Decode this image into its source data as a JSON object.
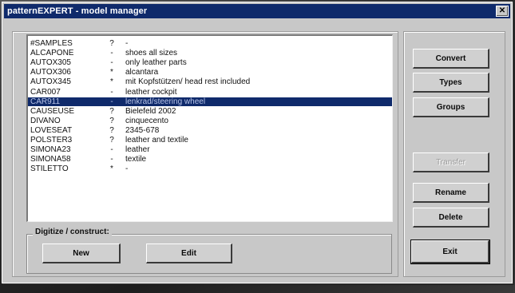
{
  "window": {
    "title": "patternEXPERT - model manager",
    "close_glyph": "✕"
  },
  "list": {
    "items": [
      {
        "name": "#SAMPLES",
        "flag": "?",
        "desc": "-"
      },
      {
        "name": "ALCAPONE",
        "flag": "-",
        "desc": "shoes all sizes"
      },
      {
        "name": "AUTOX305",
        "flag": "-",
        "desc": "only leather parts"
      },
      {
        "name": "AUTOX306",
        "flag": "*",
        "desc": "alcantara"
      },
      {
        "name": "AUTOX345",
        "flag": "*",
        "desc": "mit Kopfstützen/ head rest included"
      },
      {
        "name": "CAR007",
        "flag": "-",
        "desc": "leather cockpit"
      },
      {
        "name": "CAR911",
        "flag": "-",
        "desc": "lenkrad/steering wheel"
      },
      {
        "name": "CAUSEUSE",
        "flag": "?",
        "desc": "Bielefeld 2002"
      },
      {
        "name": "DIVANO",
        "flag": "?",
        "desc": "cinquecento"
      },
      {
        "name": "LOVESEAT",
        "flag": "?",
        "desc": "2345-678"
      },
      {
        "name": "POLSTER3",
        "flag": "?",
        "desc": "leather and textile"
      },
      {
        "name": "SIMONA23",
        "flag": "-",
        "desc": "leather"
      },
      {
        "name": "SIMONA58",
        "flag": "-",
        "desc": "textile"
      },
      {
        "name": "STILETTO",
        "flag": "*",
        "desc": "-"
      }
    ],
    "selected_index": 6
  },
  "digitize": {
    "label": "Digitize / construct:",
    "new_label": "New",
    "edit_label": "Edit"
  },
  "actions": {
    "convert_label": "Convert",
    "types_label": "Types",
    "groups_label": "Groups",
    "transfer_label": "Transfer",
    "rename_label": "Rename",
    "delete_label": "Delete",
    "exit_label": "Exit"
  }
}
